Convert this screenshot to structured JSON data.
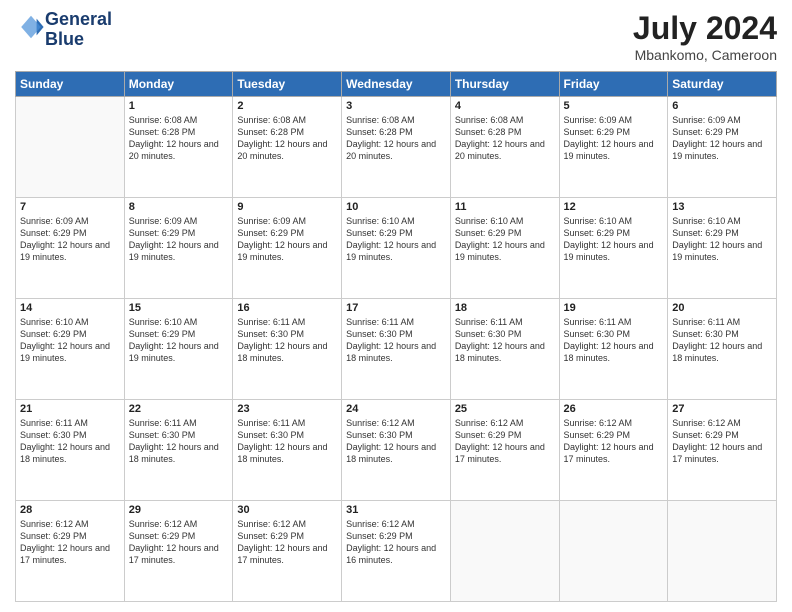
{
  "logo": {
    "line1": "General",
    "line2": "Blue"
  },
  "title": "July 2024",
  "subtitle": "Mbankomo, Cameroon",
  "days_of_week": [
    "Sunday",
    "Monday",
    "Tuesday",
    "Wednesday",
    "Thursday",
    "Friday",
    "Saturday"
  ],
  "weeks": [
    [
      {
        "day": "",
        "info": ""
      },
      {
        "day": "1",
        "info": "Sunrise: 6:08 AM\nSunset: 6:28 PM\nDaylight: 12 hours\nand 20 minutes."
      },
      {
        "day": "2",
        "info": "Sunrise: 6:08 AM\nSunset: 6:28 PM\nDaylight: 12 hours\nand 20 minutes."
      },
      {
        "day": "3",
        "info": "Sunrise: 6:08 AM\nSunset: 6:28 PM\nDaylight: 12 hours\nand 20 minutes."
      },
      {
        "day": "4",
        "info": "Sunrise: 6:08 AM\nSunset: 6:28 PM\nDaylight: 12 hours\nand 20 minutes."
      },
      {
        "day": "5",
        "info": "Sunrise: 6:09 AM\nSunset: 6:29 PM\nDaylight: 12 hours\nand 19 minutes."
      },
      {
        "day": "6",
        "info": "Sunrise: 6:09 AM\nSunset: 6:29 PM\nDaylight: 12 hours\nand 19 minutes."
      }
    ],
    [
      {
        "day": "7",
        "info": ""
      },
      {
        "day": "8",
        "info": "Sunrise: 6:09 AM\nSunset: 6:29 PM\nDaylight: 12 hours\nand 19 minutes."
      },
      {
        "day": "9",
        "info": "Sunrise: 6:09 AM\nSunset: 6:29 PM\nDaylight: 12 hours\nand 19 minutes."
      },
      {
        "day": "10",
        "info": "Sunrise: 6:10 AM\nSunset: 6:29 PM\nDaylight: 12 hours\nand 19 minutes."
      },
      {
        "day": "11",
        "info": "Sunrise: 6:10 AM\nSunset: 6:29 PM\nDaylight: 12 hours\nand 19 minutes."
      },
      {
        "day": "12",
        "info": "Sunrise: 6:10 AM\nSunset: 6:29 PM\nDaylight: 12 hours\nand 19 minutes."
      },
      {
        "day": "13",
        "info": "Sunrise: 6:10 AM\nSunset: 6:29 PM\nDaylight: 12 hours\nand 19 minutes."
      }
    ],
    [
      {
        "day": "14",
        "info": ""
      },
      {
        "day": "15",
        "info": "Sunrise: 6:10 AM\nSunset: 6:29 PM\nDaylight: 12 hours\nand 19 minutes."
      },
      {
        "day": "16",
        "info": "Sunrise: 6:11 AM\nSunset: 6:30 PM\nDaylight: 12 hours\nand 18 minutes."
      },
      {
        "day": "17",
        "info": "Sunrise: 6:11 AM\nSunset: 6:30 PM\nDaylight: 12 hours\nand 18 minutes."
      },
      {
        "day": "18",
        "info": "Sunrise: 6:11 AM\nSunset: 6:30 PM\nDaylight: 12 hours\nand 18 minutes."
      },
      {
        "day": "19",
        "info": "Sunrise: 6:11 AM\nSunset: 6:30 PM\nDaylight: 12 hours\nand 18 minutes."
      },
      {
        "day": "20",
        "info": "Sunrise: 6:11 AM\nSunset: 6:30 PM\nDaylight: 12 hours\nand 18 minutes."
      }
    ],
    [
      {
        "day": "21",
        "info": ""
      },
      {
        "day": "22",
        "info": "Sunrise: 6:11 AM\nSunset: 6:30 PM\nDaylight: 12 hours\nand 18 minutes."
      },
      {
        "day": "23",
        "info": "Sunrise: 6:11 AM\nSunset: 6:30 PM\nDaylight: 12 hours\nand 18 minutes."
      },
      {
        "day": "24",
        "info": "Sunrise: 6:12 AM\nSunset: 6:30 PM\nDaylight: 12 hours\nand 18 minutes."
      },
      {
        "day": "25",
        "info": "Sunrise: 6:12 AM\nSunset: 6:29 PM\nDaylight: 12 hours\nand 17 minutes."
      },
      {
        "day": "26",
        "info": "Sunrise: 6:12 AM\nSunset: 6:29 PM\nDaylight: 12 hours\nand 17 minutes."
      },
      {
        "day": "27",
        "info": "Sunrise: 6:12 AM\nSunset: 6:29 PM\nDaylight: 12 hours\nand 17 minutes."
      }
    ],
    [
      {
        "day": "28",
        "info": "Sunrise: 6:12 AM\nSunset: 6:29 PM\nDaylight: 12 hours\nand 17 minutes."
      },
      {
        "day": "29",
        "info": "Sunrise: 6:12 AM\nSunset: 6:29 PM\nDaylight: 12 hours\nand 17 minutes."
      },
      {
        "day": "30",
        "info": "Sunrise: 6:12 AM\nSunset: 6:29 PM\nDaylight: 12 hours\nand 17 minutes."
      },
      {
        "day": "31",
        "info": "Sunrise: 6:12 AM\nSunset: 6:29 PM\nDaylight: 12 hours\nand 16 minutes."
      },
      {
        "day": "",
        "info": ""
      },
      {
        "day": "",
        "info": ""
      },
      {
        "day": "",
        "info": ""
      }
    ]
  ],
  "week7_sunday_info": "Sunrise: 6:09 AM\nSunset: 6:29 PM\nDaylight: 12 hours\nand 19 minutes.",
  "week14_sunday_info": "Sunrise: 6:10 AM\nSunset: 6:29 PM\nDaylight: 12 hours\nand 19 minutes.",
  "week21_sunday_info": "Sunrise: 6:11 AM\nSunset: 6:30 PM\nDaylight: 12 hours\nand 18 minutes.",
  "week21_sunday_info2": "Sunrise: 6:11 AM\nSunset: 6:30 PM\nDaylight: 12 hours\nand 18 minutes."
}
